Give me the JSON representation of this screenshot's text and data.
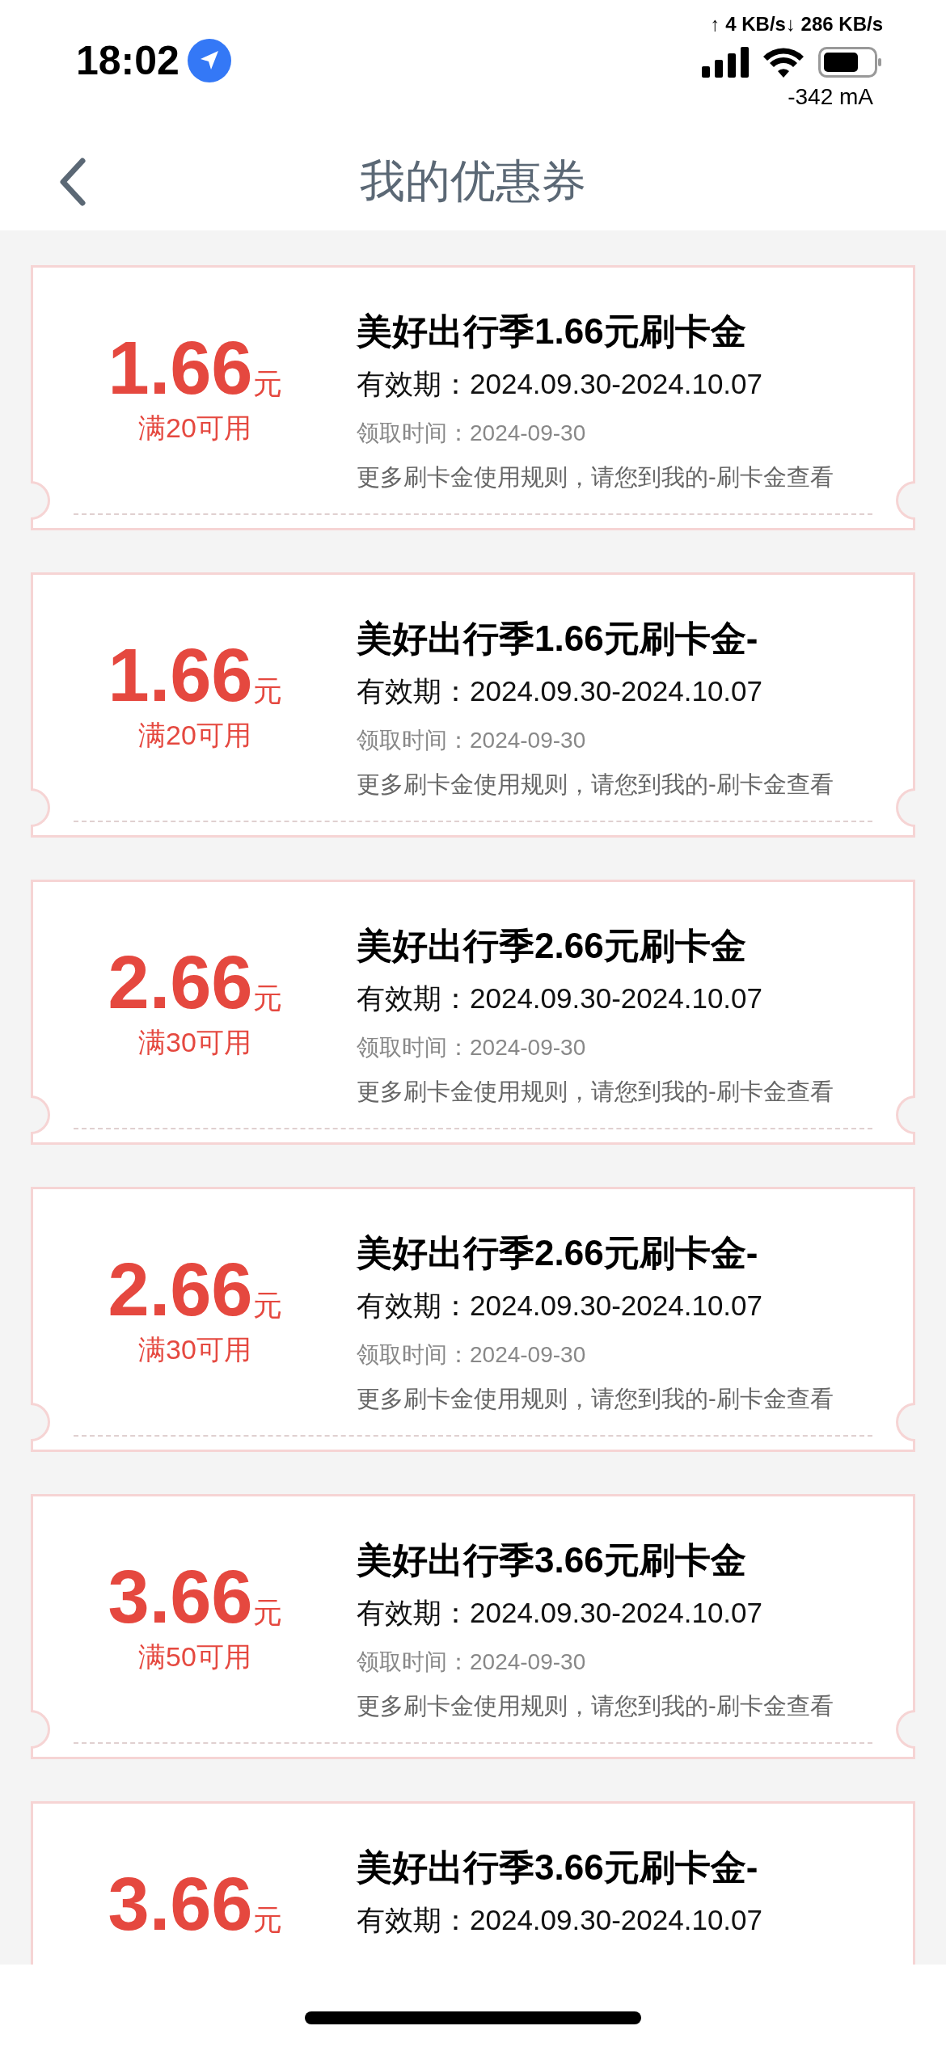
{
  "status_bar": {
    "time": "18:02",
    "net_speed": "↑ 4 KB/s↓ 286 KB/s",
    "current": "-342 mA"
  },
  "nav": {
    "title": "我的优惠券"
  },
  "coupons": [
    {
      "amount": "1.66",
      "unit": "元",
      "condition": "满20可用",
      "title": "美好出行季1.66元刷卡金",
      "validity": "有效期：2024.09.30-2024.10.07",
      "claimed": "领取时间：2024-09-30",
      "note": "更多刷卡金使用规则，请您到我的-刷卡金查看"
    },
    {
      "amount": "1.66",
      "unit": "元",
      "condition": "满20可用",
      "title": "美好出行季1.66元刷卡金-",
      "validity": "有效期：2024.09.30-2024.10.07",
      "claimed": "领取时间：2024-09-30",
      "note": "更多刷卡金使用规则，请您到我的-刷卡金查看"
    },
    {
      "amount": "2.66",
      "unit": "元",
      "condition": "满30可用",
      "title": "美好出行季2.66元刷卡金",
      "validity": "有效期：2024.09.30-2024.10.07",
      "claimed": "领取时间：2024-09-30",
      "note": "更多刷卡金使用规则，请您到我的-刷卡金查看"
    },
    {
      "amount": "2.66",
      "unit": "元",
      "condition": "满30可用",
      "title": "美好出行季2.66元刷卡金-",
      "validity": "有效期：2024.09.30-2024.10.07",
      "claimed": "领取时间：2024-09-30",
      "note": "更多刷卡金使用规则，请您到我的-刷卡金查看"
    },
    {
      "amount": "3.66",
      "unit": "元",
      "condition": "满50可用",
      "title": "美好出行季3.66元刷卡金",
      "validity": "有效期：2024.09.30-2024.10.07",
      "claimed": "领取时间：2024-09-30",
      "note": "更多刷卡金使用规则，请您到我的-刷卡金查看"
    },
    {
      "amount": "3.66",
      "unit": "元",
      "title": "美好出行季3.66元刷卡金-",
      "validity": "有效期：2024.09.30-2024.10.07"
    }
  ]
}
